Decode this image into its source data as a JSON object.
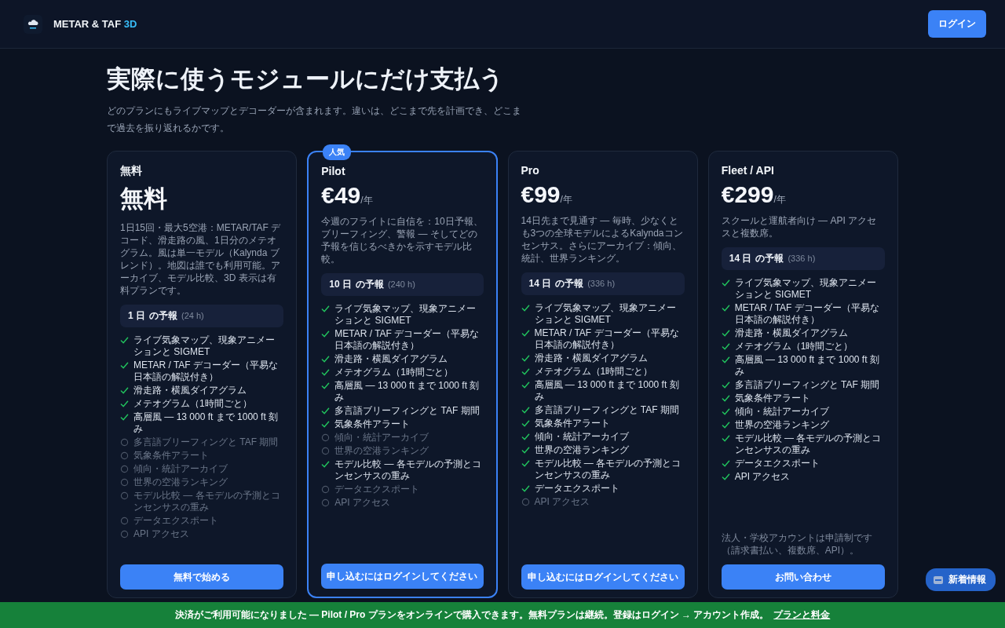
{
  "header": {
    "brand": "METAR & TAF",
    "brand_accent": "3D",
    "login": "ログイン"
  },
  "hero": {
    "title": "実際に使うモジュールにだけ支払う",
    "subtitle": "どのプランにもライブマップとデコーダーが含まれます。違いは、どこまで先を計画でき、どこまで過去を振り返れるかです。"
  },
  "plans": [
    {
      "name": "無料",
      "featured": false,
      "price": "無料",
      "description": "1日15回・最大5空港：METAR/TAF デコード、滑走路の風、1日分のメテオグラム。風は単一モデル（Kalynda ブレンド）。地図は誰でも利用可能。アーカイブ、モデル比較、3D 表示は有料プランです。",
      "forecast": {
        "days": "1 日",
        "label": "の予報",
        "hours": "(24 h)"
      },
      "features": [
        {
          "text": "ライブ気象マップ、現象アニメーションと SIGMET",
          "included": true
        },
        {
          "text": "METAR / TAF デコーダー（平易な日本語の解説付き）",
          "included": true
        },
        {
          "text": "滑走路・横風ダイアグラム",
          "included": true
        },
        {
          "text": "メテオグラム（1時間ごと）",
          "included": true
        },
        {
          "text": "高層風 — 13 000 ft まで 1000 ft 刻み",
          "included": true
        },
        {
          "text": "多言語ブリーフィングと TAF 期間",
          "included": false
        },
        {
          "text": "気象条件アラート",
          "included": false
        },
        {
          "text": "傾向・統計アーカイブ",
          "included": false
        },
        {
          "text": "世界の空港ランキング",
          "included": false
        },
        {
          "text": "モデル比較 — 各モデルの予測とコンセンサスの重み",
          "included": false
        },
        {
          "text": "データエクスポート",
          "included": false
        },
        {
          "text": "API アクセス",
          "included": false
        }
      ],
      "cta": "無料で始める"
    },
    {
      "name": "Pilot",
      "badge": "人気",
      "featured": true,
      "price": "€49",
      "period": "/年",
      "description": "今週のフライトに自信を：10日予報、ブリーフィング、警報 — そしてどの予報を信じるべきかを示すモデル比較。",
      "forecast": {
        "days": "10 日",
        "label": "の予報",
        "hours": "(240 h)"
      },
      "features": [
        {
          "text": "ライブ気象マップ、現象アニメーションと SIGMET",
          "included": true
        },
        {
          "text": "METAR / TAF デコーダー（平易な日本語の解説付き）",
          "included": true
        },
        {
          "text": "滑走路・横風ダイアグラム",
          "included": true
        },
        {
          "text": "メテオグラム（1時間ごと）",
          "included": true
        },
        {
          "text": "高層風 — 13 000 ft まで 1000 ft 刻み",
          "included": true
        },
        {
          "text": "多言語ブリーフィングと TAF 期間",
          "included": true
        },
        {
          "text": "気象条件アラート",
          "included": true
        },
        {
          "text": "傾向・統計アーカイブ",
          "included": false
        },
        {
          "text": "世界の空港ランキング",
          "included": false
        },
        {
          "text": "モデル比較 — 各モデルの予測とコンセンサスの重み",
          "included": true
        },
        {
          "text": "データエクスポート",
          "included": false
        },
        {
          "text": "API アクセス",
          "included": false
        }
      ],
      "cta": "申し込むにはログインしてください"
    },
    {
      "name": "Pro",
      "featured": false,
      "price": "€99",
      "period": "/年",
      "description": "14日先まで見通す — 毎時、少なくとも3つの全球モデルによるKalyndaコンセンサス。さらにアーカイブ：傾向、統計、世界ランキング。",
      "forecast": {
        "days": "14 日",
        "label": "の予報",
        "hours": "(336 h)"
      },
      "features": [
        {
          "text": "ライブ気象マップ、現象アニメーションと SIGMET",
          "included": true
        },
        {
          "text": "METAR / TAF デコーダー（平易な日本語の解説付き）",
          "included": true
        },
        {
          "text": "滑走路・横風ダイアグラム",
          "included": true
        },
        {
          "text": "メテオグラム（1時間ごと）",
          "included": true
        },
        {
          "text": "高層風 — 13 000 ft まで 1000 ft 刻み",
          "included": true
        },
        {
          "text": "多言語ブリーフィングと TAF 期間",
          "included": true
        },
        {
          "text": "気象条件アラート",
          "included": true
        },
        {
          "text": "傾向・統計アーカイブ",
          "included": true
        },
        {
          "text": "世界の空港ランキング",
          "included": true
        },
        {
          "text": "モデル比較 — 各モデルの予測とコンセンサスの重み",
          "included": true
        },
        {
          "text": "データエクスポート",
          "included": true
        },
        {
          "text": "API アクセス",
          "included": false
        }
      ],
      "cta": "申し込むにはログインしてください"
    },
    {
      "name": "Fleet / API",
      "featured": false,
      "price": "€299",
      "period": "/年",
      "description": "スクールと運航者向け — API アクセスと複数席。",
      "forecast": {
        "days": "14 日",
        "label": "の予報",
        "hours": "(336 h)"
      },
      "features": [
        {
          "text": "ライブ気象マップ、現象アニメーションと SIGMET",
          "included": true
        },
        {
          "text": "METAR / TAF デコーダー（平易な日本語の解説付き）",
          "included": true
        },
        {
          "text": "滑走路・横風ダイアグラム",
          "included": true
        },
        {
          "text": "メテオグラム（1時間ごと）",
          "included": true
        },
        {
          "text": "高層風 — 13 000 ft まで 1000 ft 刻み",
          "included": true
        },
        {
          "text": "多言語ブリーフィングと TAF 期間",
          "included": true
        },
        {
          "text": "気象条件アラート",
          "included": true
        },
        {
          "text": "傾向・統計アーカイブ",
          "included": true
        },
        {
          "text": "世界の空港ランキング",
          "included": true
        },
        {
          "text": "モデル比較 — 各モデルの予測とコンセンサスの重み",
          "included": true
        },
        {
          "text": "データエクスポート",
          "included": true
        },
        {
          "text": "API アクセス",
          "included": true
        }
      ],
      "note": "法人・学校アカウントは申請制です（請求書払い、複数席、API）。",
      "cta": "お問い合わせ"
    }
  ],
  "news_button": "新着情報",
  "banner": {
    "text": "決済がご利用可能になりました — Pilot / Pro プランをオンラインで購入できます。無料プランは継続。登録はログイン → アカウント作成。",
    "link": "プランと料金"
  }
}
